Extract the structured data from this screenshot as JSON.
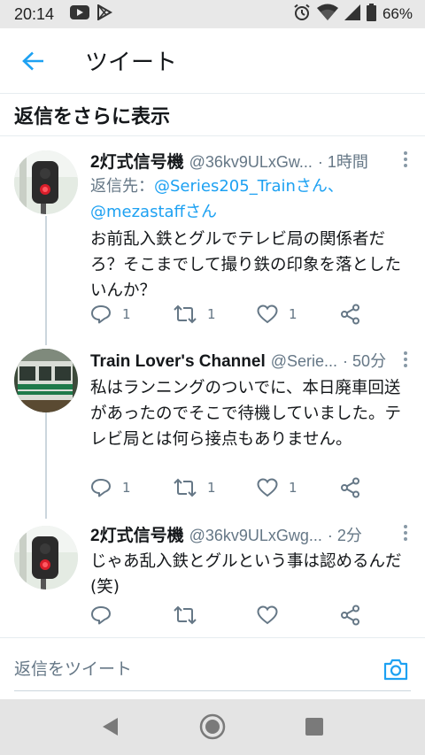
{
  "status_bar": {
    "time": "20:14",
    "battery_percent": "66%",
    "icons": [
      "youtube-icon",
      "play-store-icon",
      "alarm-icon",
      "wifi-icon",
      "signal-icon",
      "battery-icon"
    ]
  },
  "app_bar": {
    "title": "ツイート"
  },
  "show_more_replies": "返信をさらに表示",
  "tweets": [
    {
      "name": "2灯式信号機",
      "handle": "@36kv9ULxGw...",
      "time": "· 1時間",
      "replying_prefix": "返信先：",
      "replying_mention1": "@Series205_Trainさん、",
      "replying_mention2": "@mezastaffさん",
      "text": "お前乱入鉄とグルでテレビ局の関係者だろ？そこまでして撮り鉄の印象を落としたいんか？",
      "reply_count": "1",
      "retweet_count": "1",
      "like_count": "1"
    },
    {
      "name": "Train Lover's Channel",
      "handle": "@Serie...",
      "time": "· 50分",
      "text": "私はランニングのついでに、本日廃車回送があったのでそこで待機していました。テレビ局とは何ら接点もありません。",
      "reply_count": "1",
      "retweet_count": "1",
      "like_count": "1"
    },
    {
      "name": "2灯式信号機",
      "handle": "@36kv9ULxGwg...",
      "time": "· 2分",
      "text": "じゃあ乱入鉄とグルという事は認めるんだ(笑)",
      "reply_count": "",
      "retweet_count": "",
      "like_count": ""
    }
  ],
  "reply_bar": {
    "placeholder": "返信をツイート"
  },
  "colors": {
    "accent": "#1da1f2",
    "text_primary": "#14171a",
    "text_secondary": "#657786",
    "divider": "#e6ecf0"
  }
}
